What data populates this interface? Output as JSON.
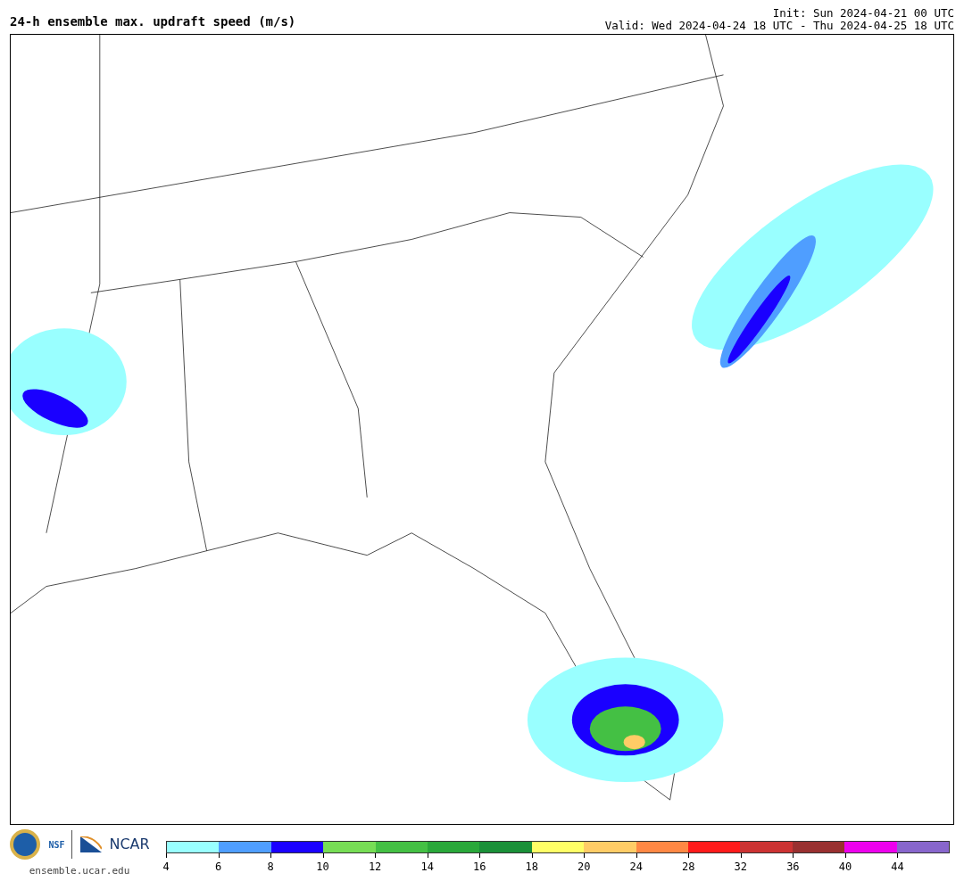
{
  "title": "24-h ensemble max. updraft speed (m/s)",
  "init": "Init: Sun 2024-04-21 00 UTC",
  "valid": "Valid: Wed 2024-04-24 18 UTC - Thu 2024-04-25 18 UTC",
  "logos": {
    "nsf": "NSF",
    "ncar": "NCAR",
    "site": "ensemble.ucar.edu"
  },
  "colorbar": [
    {
      "color": "#99ffff",
      "label": "4"
    },
    {
      "color": "#4f9eff",
      "label": "6"
    },
    {
      "color": "#1a00ff",
      "label": "8"
    },
    {
      "color": "#77dd55",
      "label": "10"
    },
    {
      "color": "#44c044",
      "label": "12"
    },
    {
      "color": "#2aa83a",
      "label": "14"
    },
    {
      "color": "#1a9038",
      "label": "16"
    },
    {
      "color": "#ffff66",
      "label": "18"
    },
    {
      "color": "#ffcc66",
      "label": "20"
    },
    {
      "color": "#ff8844",
      "label": "24"
    },
    {
      "color": "#ff1a1a",
      "label": "28"
    },
    {
      "color": "#cc3333",
      "label": "32"
    },
    {
      "color": "#993030",
      "label": "36"
    },
    {
      "color": "#ee00ee",
      "label": "40"
    },
    {
      "color": "#8866cc",
      "label": "44"
    }
  ]
}
